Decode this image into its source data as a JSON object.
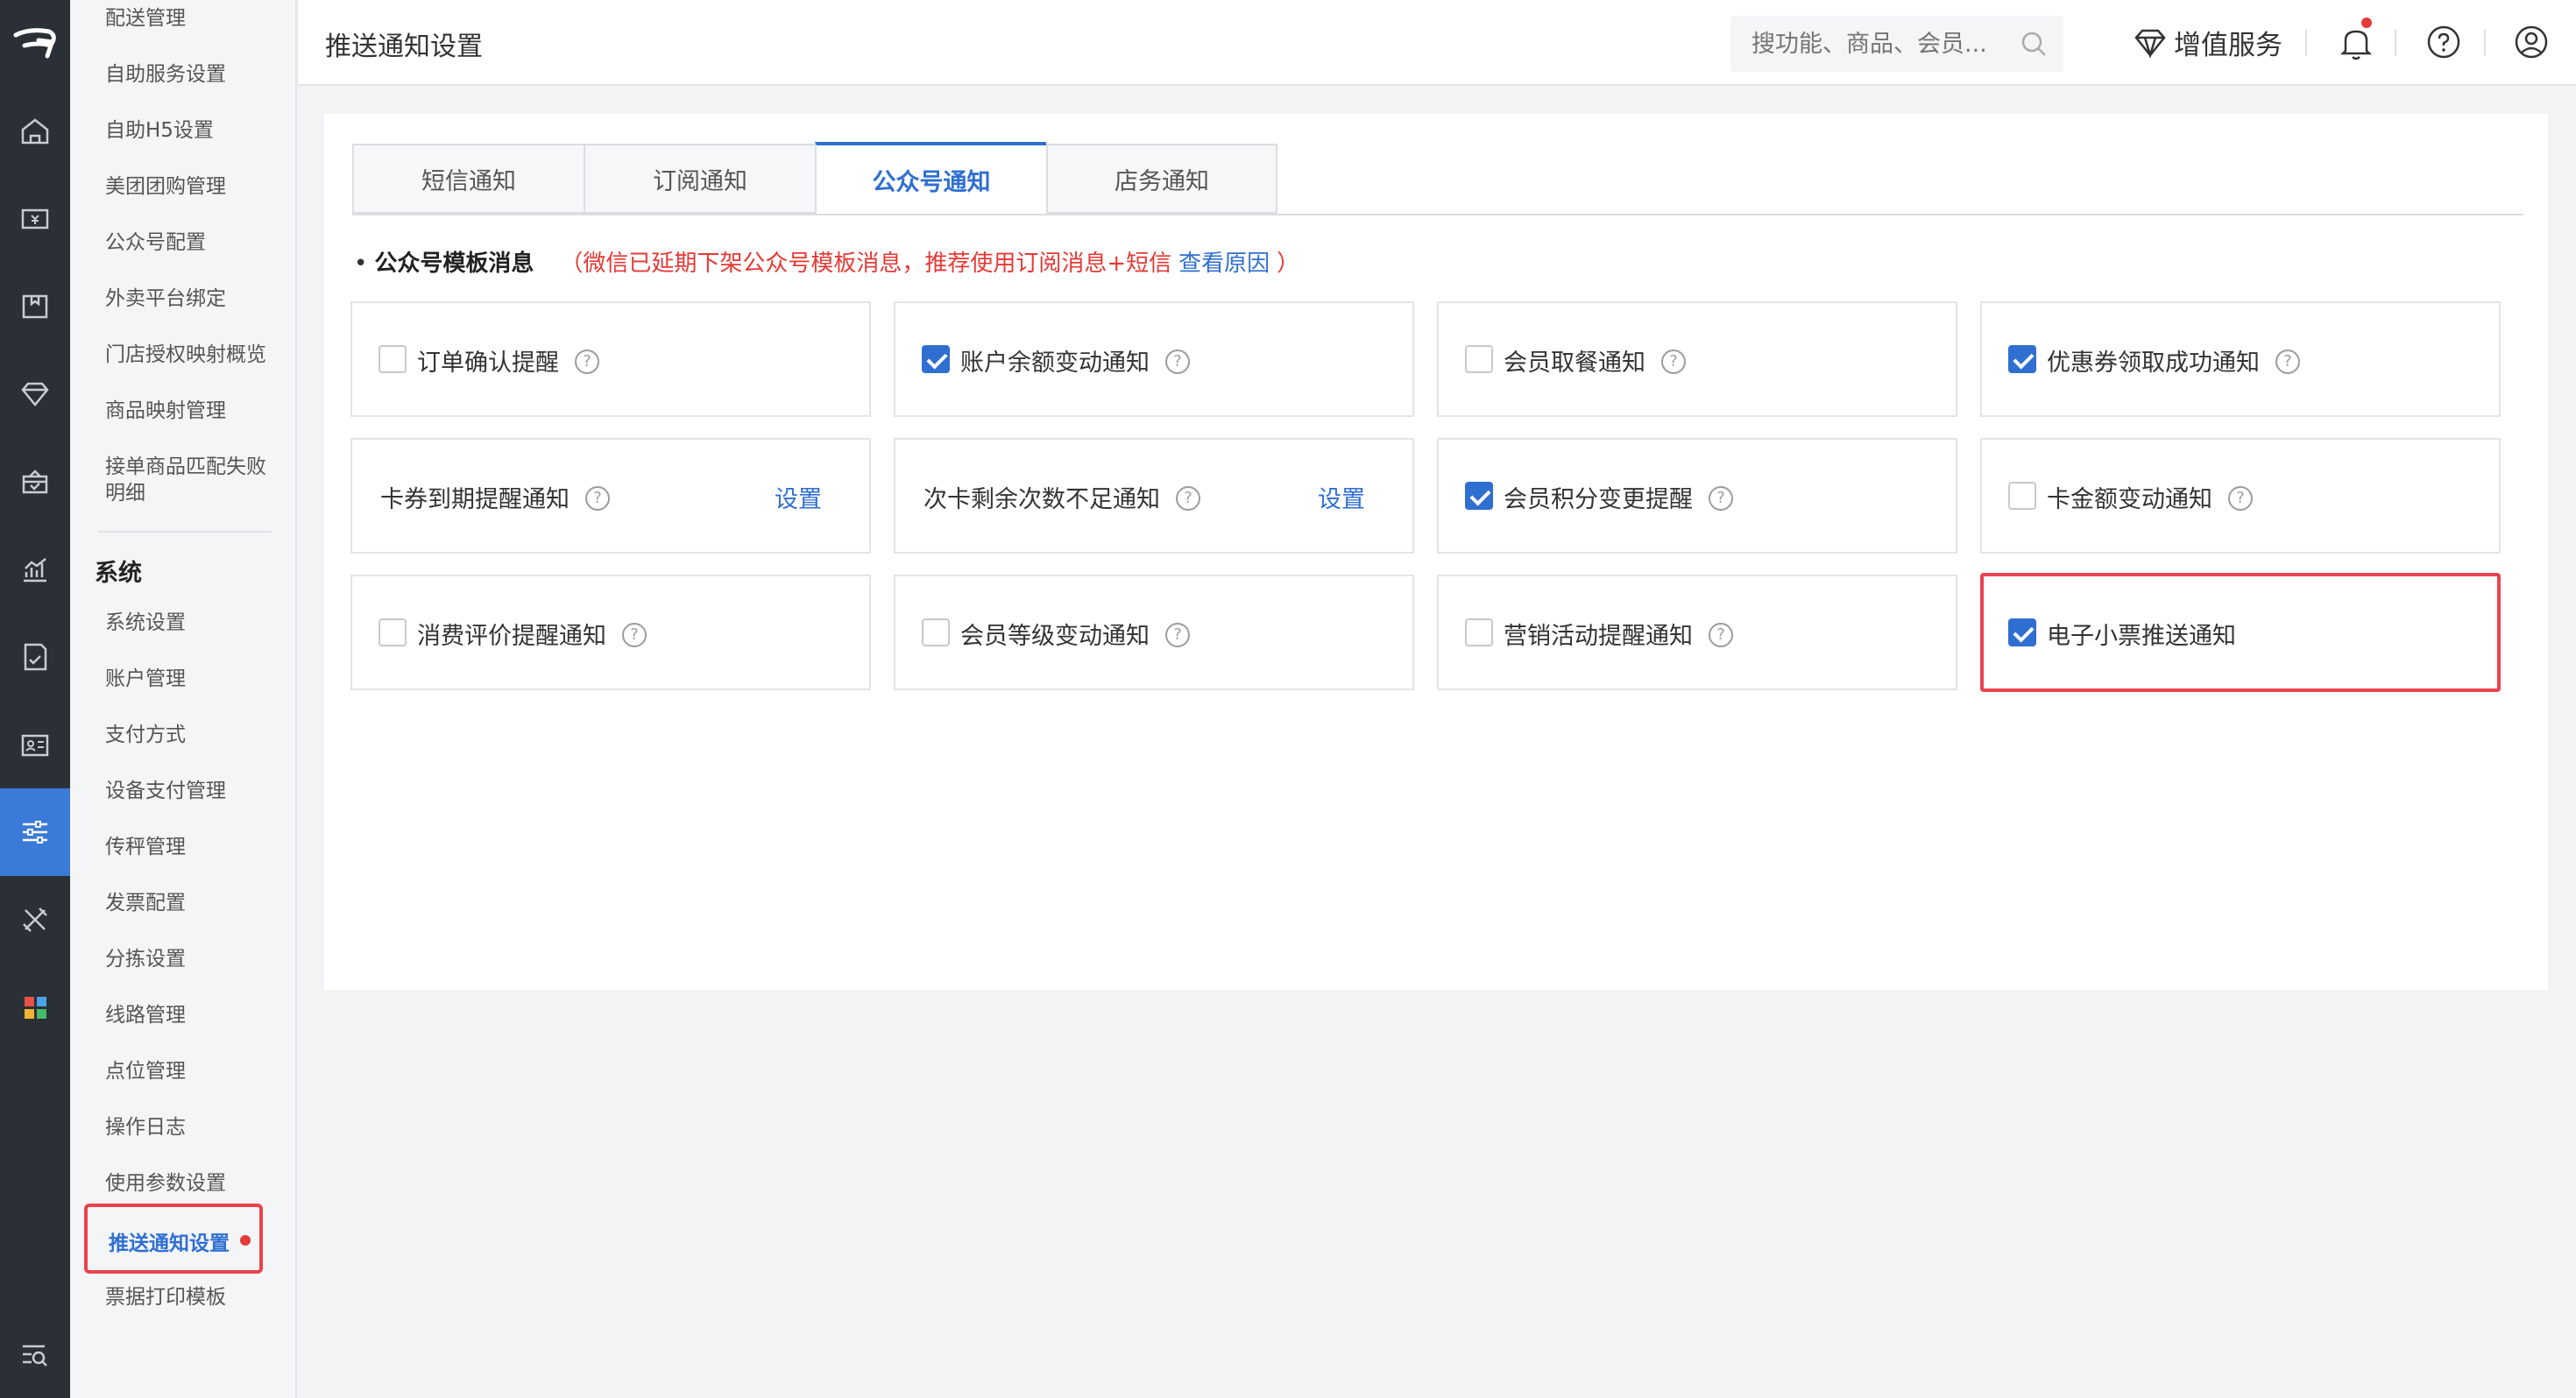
{
  "header": {
    "title": "推送通知设置",
    "search_placeholder": "搜功能、商品、会员...",
    "vas_label": "增值服务"
  },
  "submenu": {
    "items_top": [
      "配送管理",
      "自助服务设置",
      "自助H5设置",
      "美团团购管理",
      "公众号配置",
      "外卖平台绑定",
      "门店授权映射概览",
      "商品映射管理",
      "接单商品匹配失败",
      "明细"
    ],
    "group_title": "系统",
    "items_system": [
      "系统设置",
      "账户管理",
      "支付方式",
      "设备支付管理",
      "传秤管理",
      "发票配置",
      "分拣设置",
      "线路管理",
      "点位管理",
      "操作日志",
      "使用参数设置"
    ],
    "active_item": "推送通知设置",
    "items_after": [
      "票据打印模板"
    ]
  },
  "tabs": [
    "短信通知",
    "订阅通知",
    "公众号通知",
    "店务通知"
  ],
  "active_tab": "公众号通知",
  "section": {
    "bullet": "•",
    "title": "公众号模板消息",
    "warning": "（微信已延期下架公众号模板消息，推荐使用订阅消息+短信",
    "link": "查看原因",
    "close": "）"
  },
  "help_glyph": "?",
  "set_label": "设置",
  "options": [
    {
      "label": "订单确认提醒",
      "checked": false,
      "checkbox": true,
      "help": true
    },
    {
      "label": "账户余额变动通知",
      "checked": true,
      "checkbox": true,
      "help": true
    },
    {
      "label": "会员取餐通知",
      "checked": false,
      "checkbox": true,
      "help": true
    },
    {
      "label": "优惠券领取成功通知",
      "checked": true,
      "checkbox": true,
      "help": true
    },
    {
      "label": "卡券到期提醒通知",
      "checkbox": false,
      "help": true,
      "has_setting": true
    },
    {
      "label": "次卡剩余次数不足通知",
      "checkbox": false,
      "help": true,
      "has_setting": true
    },
    {
      "label": "会员积分变更提醒",
      "checked": true,
      "checkbox": true,
      "help": true
    },
    {
      "label": "卡金额变动通知",
      "checked": false,
      "checkbox": true,
      "help": true
    },
    {
      "label": "消费评价提醒通知",
      "checked": false,
      "checkbox": true,
      "help": true
    },
    {
      "label": "会员等级变动通知",
      "checked": false,
      "checkbox": true,
      "help": true
    },
    {
      "label": "营销活动提醒通知",
      "checked": false,
      "checkbox": true,
      "help": true
    },
    {
      "label": "电子小票推送通知",
      "checked": true,
      "checkbox": true,
      "help": false,
      "highlighted": true
    }
  ],
  "colors": {
    "accent": "#2f6fd1",
    "warning": "#e53935",
    "highlight": "#e8434d",
    "rail": "#2b2f36"
  }
}
